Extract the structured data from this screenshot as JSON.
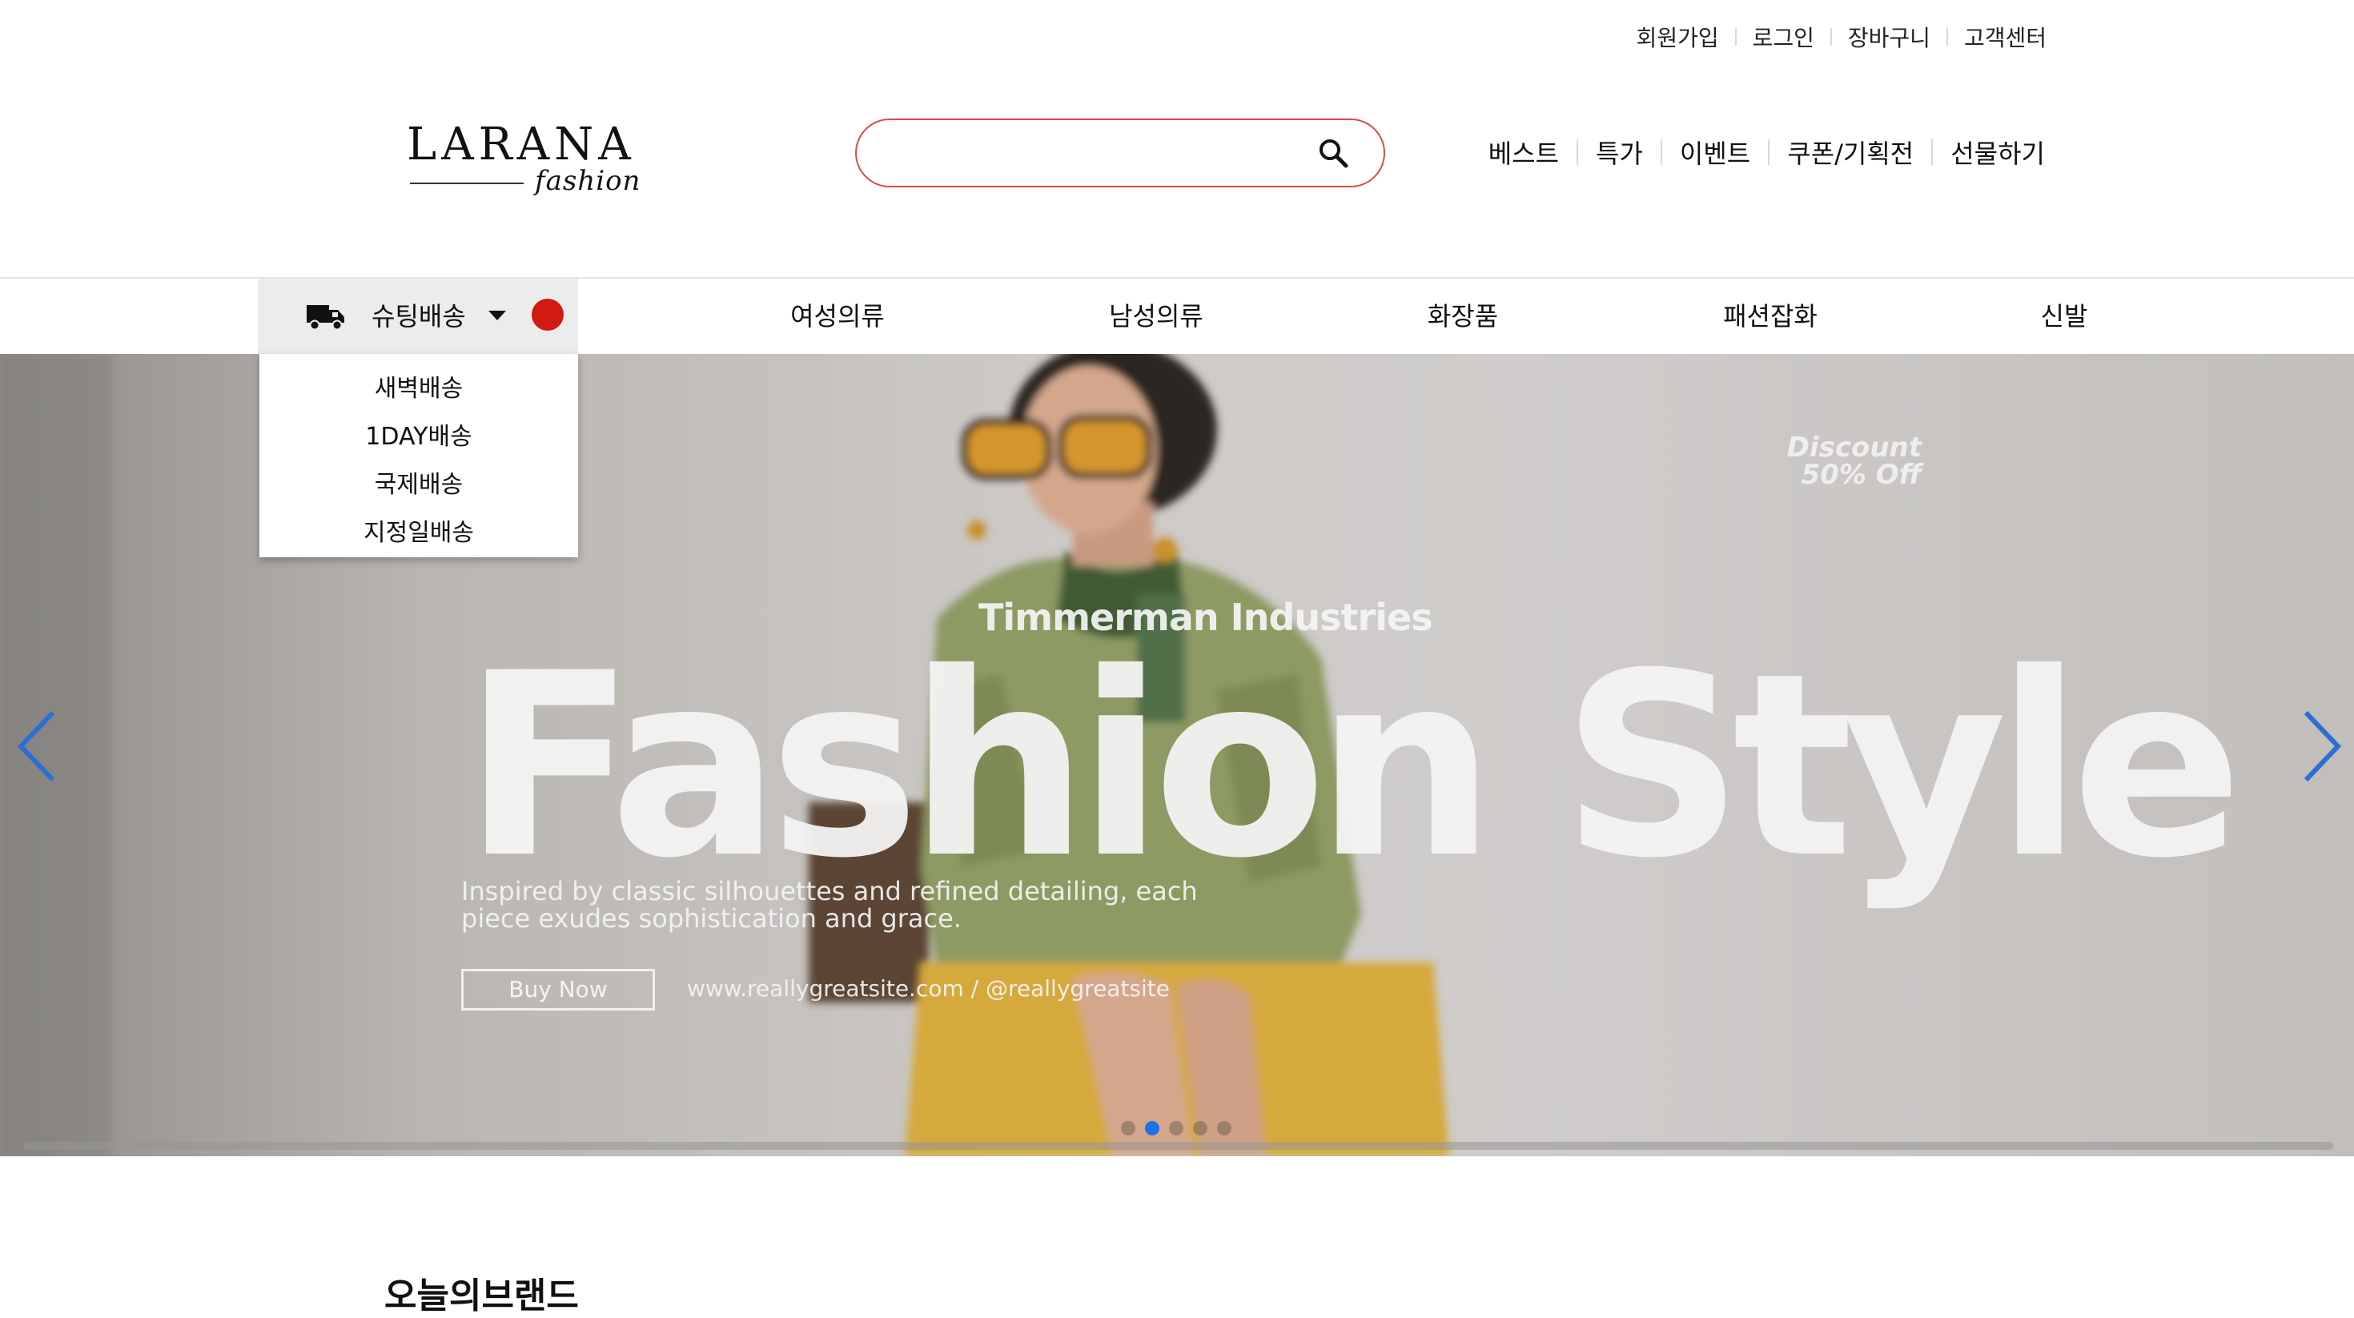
{
  "utility_links": [
    "회원가입",
    "로그인",
    "장바구니",
    "고객센터"
  ],
  "logo": {
    "main": "LARANA",
    "sub": "fashion"
  },
  "search": {
    "value": "",
    "placeholder": ""
  },
  "secondary_nav": [
    "베스트",
    "특가",
    "이벤트",
    "쿠폰/기획전",
    "선물하기"
  ],
  "shipping_menu": {
    "label": "슈팅배송",
    "options": [
      "새벽배송",
      "1DAY배송",
      "국제배송",
      "지정일배송"
    ]
  },
  "categories": [
    "여성의류",
    "남성의류",
    "화장품",
    "패션잡화",
    "신발"
  ],
  "banner": {
    "discount_line1": "Discount",
    "discount_line2": "50% Off",
    "company": "Timmerman Industries",
    "headline": "Fashion Style",
    "desc_line1": "Inspired by classic silhouettes and refined detailing, each",
    "desc_line2": "piece exudes sophistication and grace.",
    "button": "Buy Now",
    "site": "www.reallygreatsite.com / @reallygreatsite",
    "slide_count": 5,
    "active_slide": 2
  },
  "section_title": "오늘의브랜드",
  "colors": {
    "accent_red": "#d11a12",
    "search_border": "#e04a44",
    "arrow_blue": "#2b6fd6",
    "active_dot": "#1a73e8"
  }
}
